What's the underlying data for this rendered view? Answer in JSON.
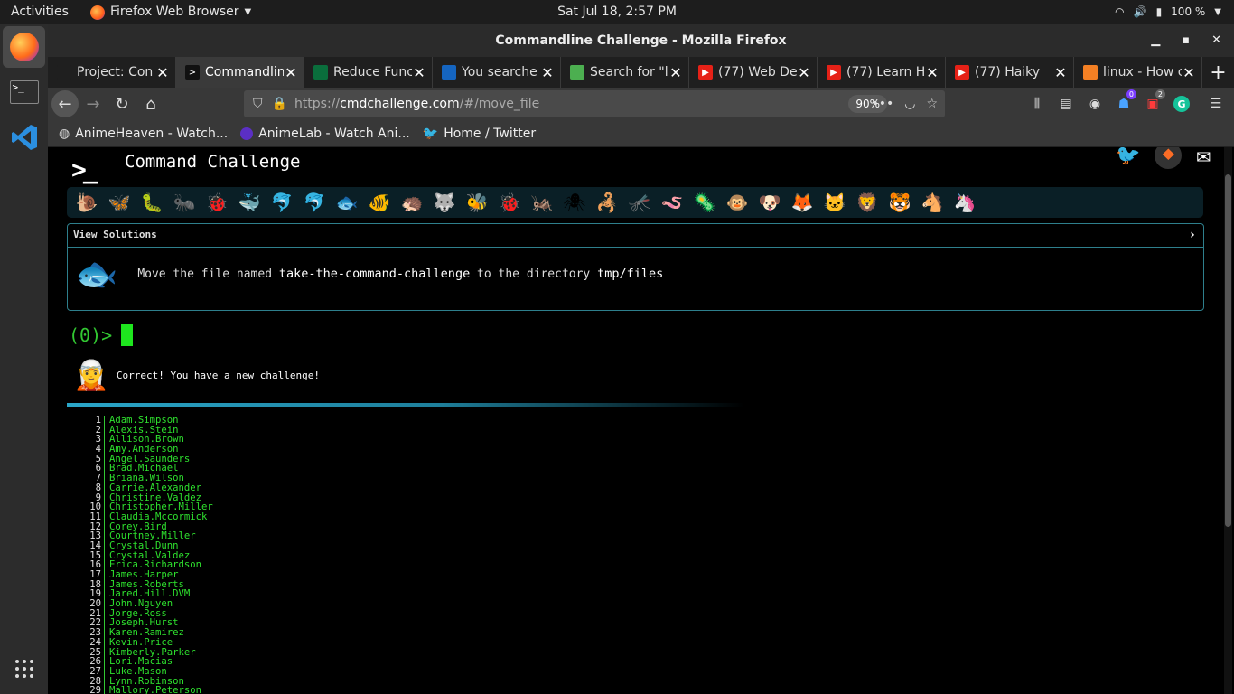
{
  "topbar": {
    "activities": "Activities",
    "app_menu": "Firefox Web Browser",
    "clock": "Sat Jul 18,  2:57 PM",
    "battery": "100 %"
  },
  "window": {
    "title": "Commandline Challenge - Mozilla Firefox"
  },
  "tabs": [
    {
      "title": "Project: Con",
      "favicon_color": "#1f1f1f",
      "favicon": "github-icon"
    },
    {
      "title": "Commandlin",
      "favicon_color": "#111111",
      "favicon": "terminal-icon",
      "active": true
    },
    {
      "title": "Reduce Func",
      "favicon_color": "#0a6e3c",
      "favicon": "devto-icon"
    },
    {
      "title": "You searche",
      "favicon_color": "#1565c0",
      "favicon": "circle-icon"
    },
    {
      "title": "Search for \"l",
      "favicon_color": "#4caf50",
      "favicon": "udemy-icon"
    },
    {
      "title": "(77) Web De",
      "favicon_color": "#e62117",
      "favicon": "youtube-icon"
    },
    {
      "title": "(77) Learn H",
      "favicon_color": "#e62117",
      "favicon": "youtube-icon"
    },
    {
      "title": "(77) Haiky",
      "favicon_color": "#e62117",
      "favicon": "youtube-icon"
    },
    {
      "title": "linux - How c",
      "favicon_color": "#f48024",
      "favicon": "stackoverflow-icon"
    }
  ],
  "navbar": {
    "url_prefix": "https://",
    "url_domain": "cmdchallenge.com",
    "url_path": "/#/move_file",
    "zoom": "90%"
  },
  "bookmarks": [
    {
      "label": "AnimeHeaven - Watch...",
      "icon": "globe-icon"
    },
    {
      "label": "AnimeLab - Watch Ani...",
      "icon": "animelab-icon"
    },
    {
      "label": "Home / Twitter",
      "icon": "twitter-icon"
    }
  ],
  "page": {
    "site_title": "Command Challenge",
    "view_solutions": "View Solutions",
    "task_text_1": "Move the file named ",
    "task_file": "take-the-command-challenge",
    "task_text_2": " to the directory ",
    "task_dir": "tmp/files",
    "prompt": "(0)>",
    "feedback": "Correct! You have a new challenge!",
    "levels": [
      "🐌",
      "🦋",
      "🐛",
      "🐜",
      "🐞",
      "🐳",
      "🐬",
      "🐬",
      "🐟",
      "🐠",
      "🦔",
      "🐺",
      "🐝",
      "🐞",
      "🦗",
      "🕷",
      "🦂",
      "🦟",
      "🪱",
      "🦠",
      "🐵",
      "🐶",
      "🦊",
      "🐱",
      "🦁",
      "🐯",
      "🐴",
      "🦄"
    ]
  },
  "output": [
    "Adam.Simpson",
    "Alexis.Stein",
    "Allison.Brown",
    "Amy.Anderson",
    "Angel.Saunders",
    "Brad.Michael",
    "Briana.Wilson",
    "Carrie.Alexander",
    "Christine.Valdez",
    "Christopher.Miller",
    "Claudia.Mccormick",
    "Corey.Bird",
    "Courtney.Miller",
    "Crystal.Dunn",
    "Crystal.Valdez",
    "Erica.Richardson",
    "James.Harper",
    "James.Roberts",
    "Jared.Hill.DVM",
    "John.Nguyen",
    "Jorge.Ross",
    "Joseph.Hurst",
    "Karen.Ramirez",
    "Kevin.Price",
    "Kimberly.Parker",
    "Lori.Macias",
    "Luke.Mason",
    "Lynn.Robinson",
    "Mallory.Peterson"
  ],
  "colors": {
    "terminal_green": "#2ee02e",
    "panel_border": "#2e7f8c",
    "level_bar": "#0a1f26"
  }
}
